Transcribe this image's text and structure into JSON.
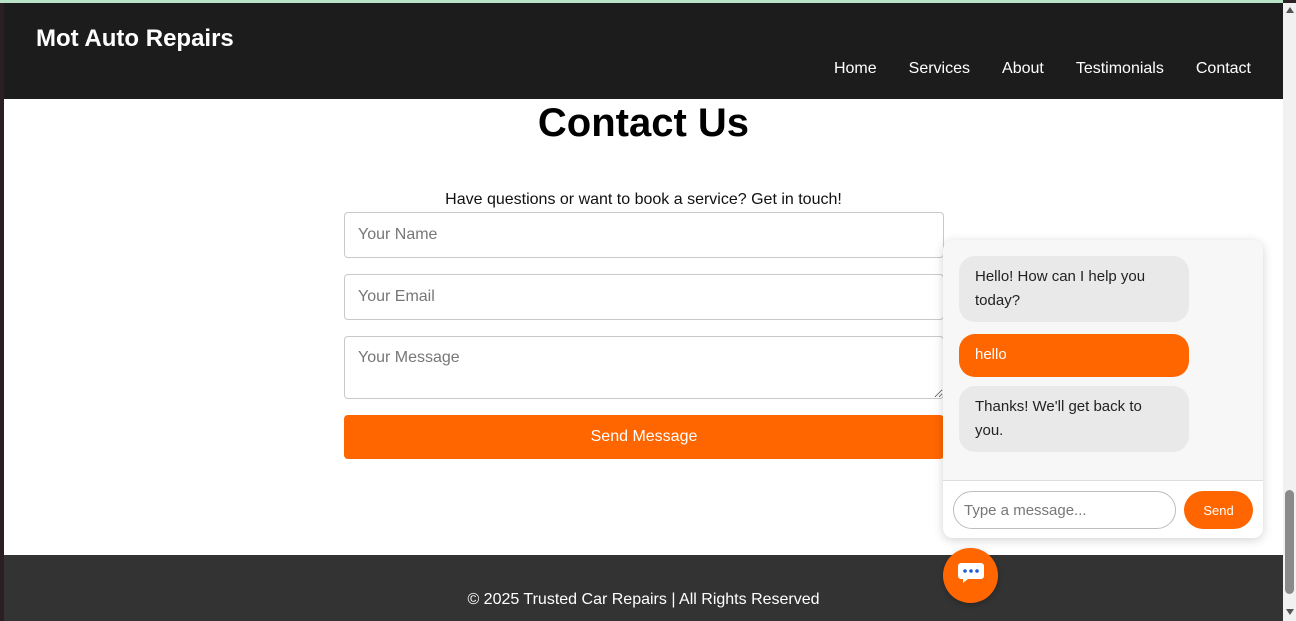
{
  "header": {
    "brand": "Mot Auto Repairs",
    "nav": [
      "Home",
      "Services",
      "About",
      "Testimonials",
      "Contact"
    ]
  },
  "contact": {
    "title": "Contact Us",
    "intro": "Have questions or want to book a service? Get in touch!",
    "name_placeholder": "Your Name",
    "email_placeholder": "Your Email",
    "message_placeholder": "Your Message",
    "submit_label": "Send Message"
  },
  "footer": {
    "text": "© 2025 Trusted Car Repairs | All Rights Reserved"
  },
  "chat": {
    "messages": [
      {
        "from": "bot",
        "text": "Hello! How can I help you today?"
      },
      {
        "from": "user",
        "text": "hello"
      },
      {
        "from": "bot",
        "text": "Thanks! We'll get back to you."
      }
    ],
    "input_placeholder": "Type a message...",
    "send_label": "Send",
    "toggle_icon": "chat-bubble-icon"
  },
  "colors": {
    "accent": "#ff6600",
    "navbar": "#1c1c1c",
    "footer": "#333333"
  }
}
